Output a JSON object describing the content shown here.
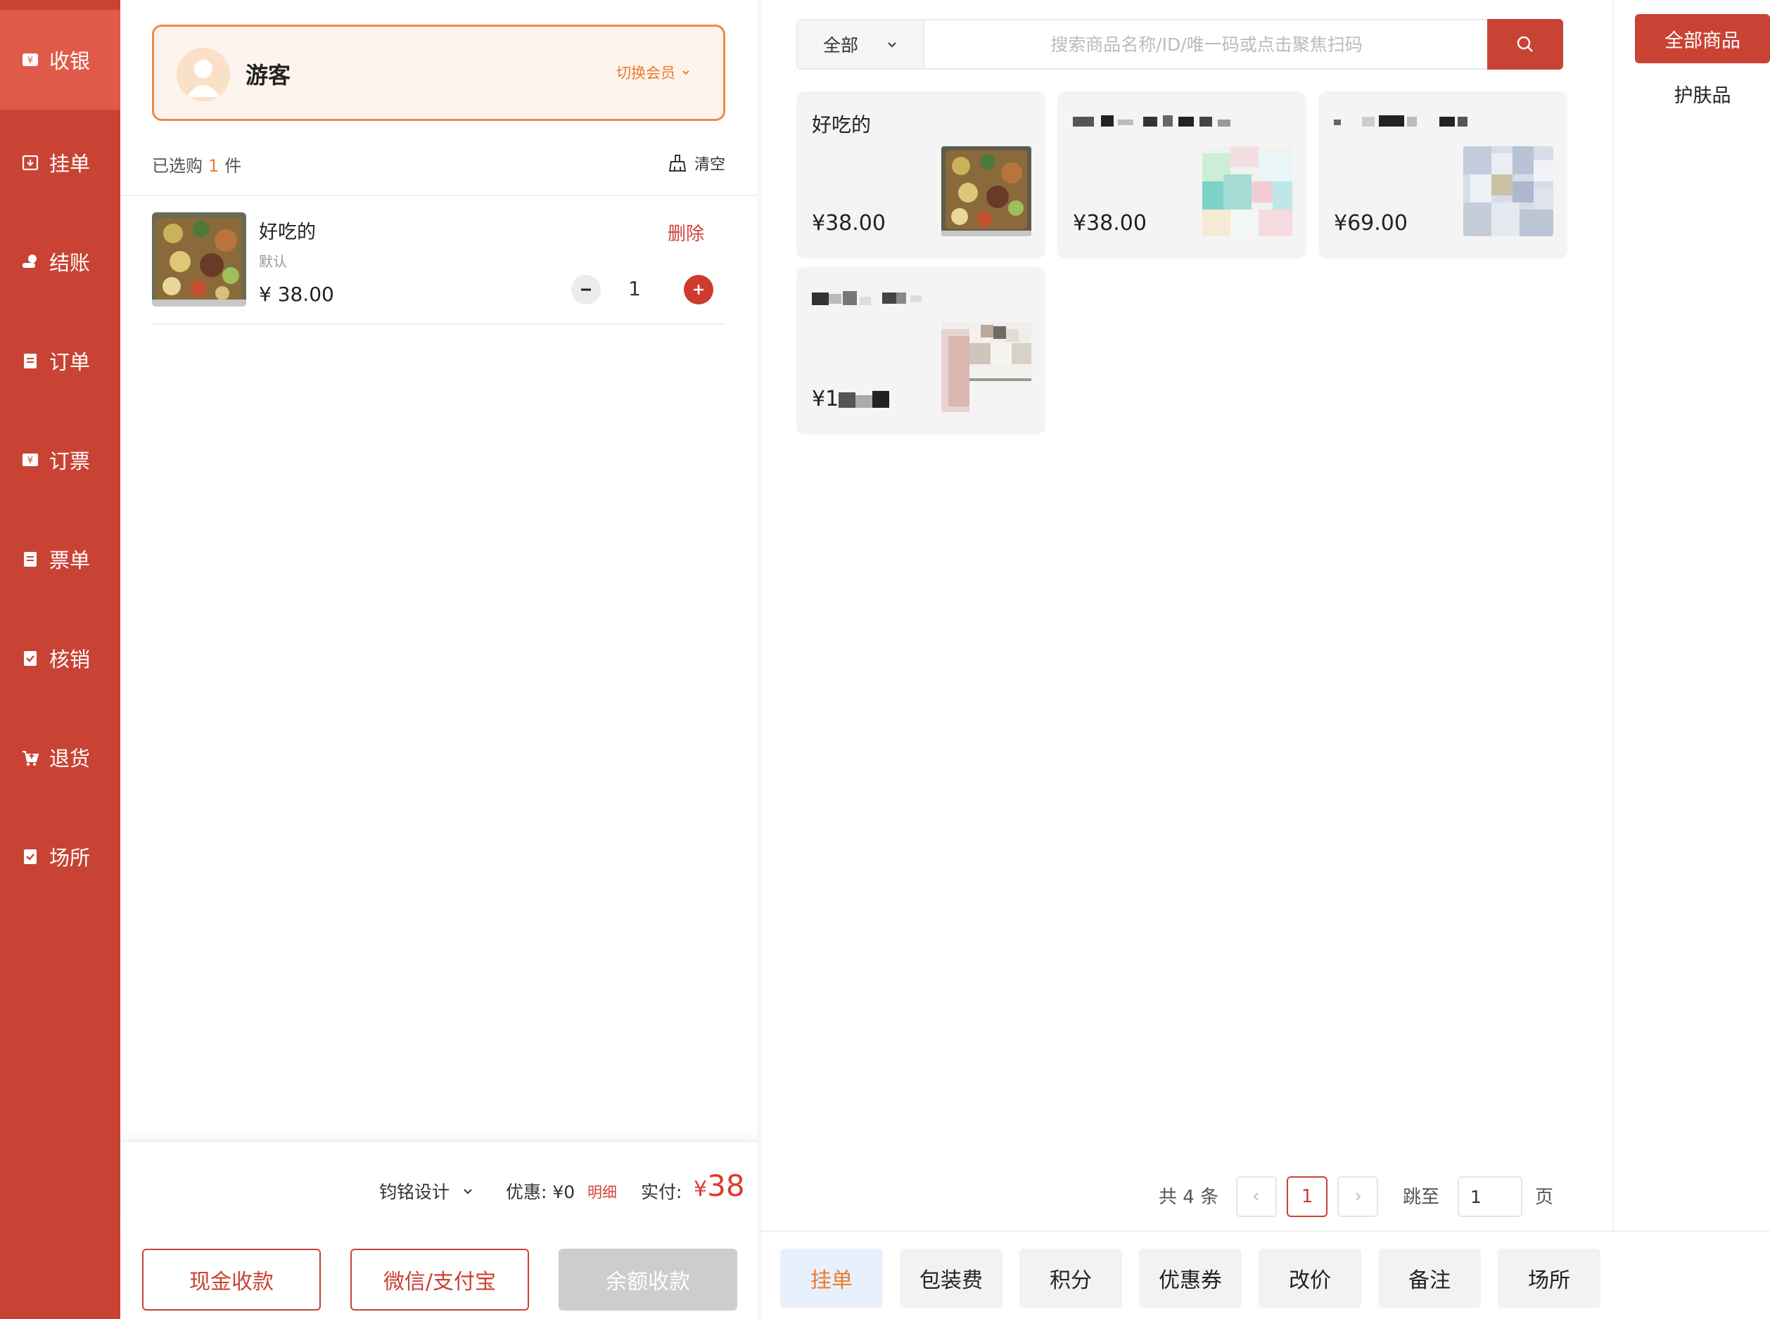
{
  "colors": {
    "primary": "#c94334",
    "accent_orange": "#ee7a2e",
    "price_red": "#e0392f"
  },
  "nav": {
    "items": [
      {
        "label": "收银",
        "icon": "cashier-icon"
      },
      {
        "label": "挂单",
        "icon": "hold-order-icon"
      },
      {
        "label": "结账",
        "icon": "checkout-icon"
      },
      {
        "label": "订单",
        "icon": "order-icon"
      },
      {
        "label": "订票",
        "icon": "ticket-booking-icon"
      },
      {
        "label": "票单",
        "icon": "ticket-list-icon"
      },
      {
        "label": "核销",
        "icon": "verify-icon"
      },
      {
        "label": "退货",
        "icon": "return-icon"
      },
      {
        "label": "场所",
        "icon": "venue-icon"
      }
    ]
  },
  "member": {
    "name": "游客",
    "switch_label": "切换会员"
  },
  "cart": {
    "picked_prefix": "已选购",
    "picked_count": "1",
    "picked_suffix": "件",
    "clear_label": "清空",
    "items": [
      {
        "name": "好吃的",
        "spec": "默认",
        "price": "¥ 38.00",
        "delete_label": "删除",
        "quantity": "1"
      }
    ],
    "staff_label": "钧铭设计",
    "discount_text": "优惠: ¥0",
    "detail_label": "明细",
    "paid_label": "实付:",
    "paid_currency": "¥",
    "paid_amount": "38"
  },
  "payment": {
    "cash": "现金收款",
    "wechat_alipay": "微信/支付宝",
    "balance": "余额收款"
  },
  "search": {
    "category": "全部",
    "placeholder": "搜索商品名称/ID/唯一码或点击聚焦扫码"
  },
  "products": [
    {
      "name": "好吃的",
      "price": "¥38.00"
    },
    {
      "name": "",
      "price": "¥38.00"
    },
    {
      "name": "",
      "price": "¥69.00"
    },
    {
      "name": "",
      "price": "¥1"
    }
  ],
  "pager": {
    "total_text": "共 4 条",
    "current_page": "1",
    "jump_label": "跳至",
    "jump_value": "1",
    "page_unit": "页"
  },
  "actions": [
    "挂单",
    "包装费",
    "积分",
    "优惠券",
    "改价",
    "备注",
    "场所"
  ],
  "categories": {
    "active": "全部商品",
    "items": [
      "护肤品"
    ]
  }
}
